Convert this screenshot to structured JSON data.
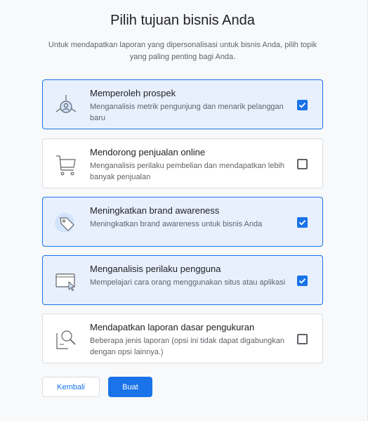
{
  "header": {
    "title": "Pilih tujuan bisnis Anda",
    "subtitle": "Untuk mendapatkan laporan yang dipersonalisasi untuk bisnis Anda, pilih topik yang paling penting bagi Anda."
  },
  "objectives": [
    {
      "title": "Memperoleh prospek",
      "description": "Menganalisis metrik pengunjung dan menarik pelanggan baru",
      "checked": true,
      "icon": "target-person-icon"
    },
    {
      "title": "Mendorong penjualan online",
      "description": "Menganalisis perilaku pembelian dan mendapatkan lebih banyak penjualan",
      "checked": false,
      "icon": "shopping-cart-icon"
    },
    {
      "title": "Meningkatkan brand awareness",
      "description": "Meningkatkan brand awareness untuk bisnis Anda",
      "checked": true,
      "icon": "tag-icon"
    },
    {
      "title": "Menganalisis perilaku pengguna",
      "description": "Mempelajari cara orang menggunakan situs atau aplikasi",
      "checked": true,
      "icon": "browser-cursor-icon"
    },
    {
      "title": "Mendapatkan laporan dasar pengukuran",
      "description": "Beberapa jenis laporan (opsi ini tidak dapat digabungkan dengan opsi lainnya.)",
      "checked": false,
      "icon": "magnifier-document-icon"
    }
  ],
  "actions": {
    "back_label": "Kembali",
    "create_label": "Buat"
  },
  "colors": {
    "accent": "#1a73e8",
    "selected_bg": "#e8f0fe",
    "page_bg": "#f8f9fa"
  }
}
